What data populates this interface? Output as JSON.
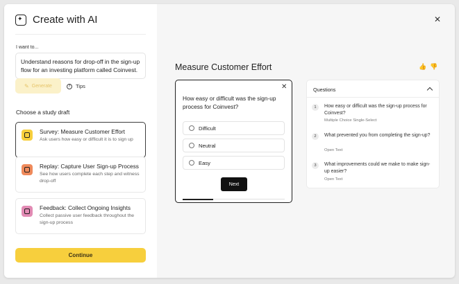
{
  "sidebar": {
    "title": "Create with AI",
    "want_label": "I want to...",
    "prompt_value": "Understand reasons for drop-off in the sign-up flow for an investing platform called Coinvest.",
    "generate_label": "Generate",
    "tips_label": "Tips",
    "choose_label": "Choose a study draft",
    "drafts": [
      {
        "title": "Survey: Measure Customer Effort",
        "desc": "Ask users how easy or difficult it is to sign up",
        "color": "#f7cf3d",
        "icon": "survey-icon"
      },
      {
        "title": "Replay: Capture User Sign-up Process",
        "desc": "See how users complete each step and witness drop-off",
        "color": "#ef8a5b",
        "icon": "replay-icon"
      },
      {
        "title": "Feedback: Collect Ongoing Insights",
        "desc": "Collect passive user feedback throughout the sign-up process",
        "color": "#e28bb4",
        "icon": "feedback-icon"
      }
    ],
    "continue_label": "Continue"
  },
  "main": {
    "survey_title": "Measure Customer Effort",
    "preview": {
      "question": "How easy or difficult was the sign-up process for Coinvest?",
      "options": [
        "Difficult",
        "Neutral",
        "Easy"
      ],
      "next_label": "Next",
      "progress": 0.3
    },
    "questions_panel": {
      "header": "Questions",
      "items": [
        {
          "num": "1",
          "text": "How easy or difficult was the sign-up process for Coinvest?",
          "type": "Multiple Choice Single-Select"
        },
        {
          "num": "2",
          "text": "What prevented you from completing the sign-up?",
          "type": "Open Text"
        },
        {
          "num": "3",
          "text": "What improvements could we make to make sign-up easier?",
          "type": "Open Text"
        }
      ]
    }
  },
  "colors": {
    "accent": "#f7cf3d",
    "accent_disabled": "#fbf1c9"
  }
}
